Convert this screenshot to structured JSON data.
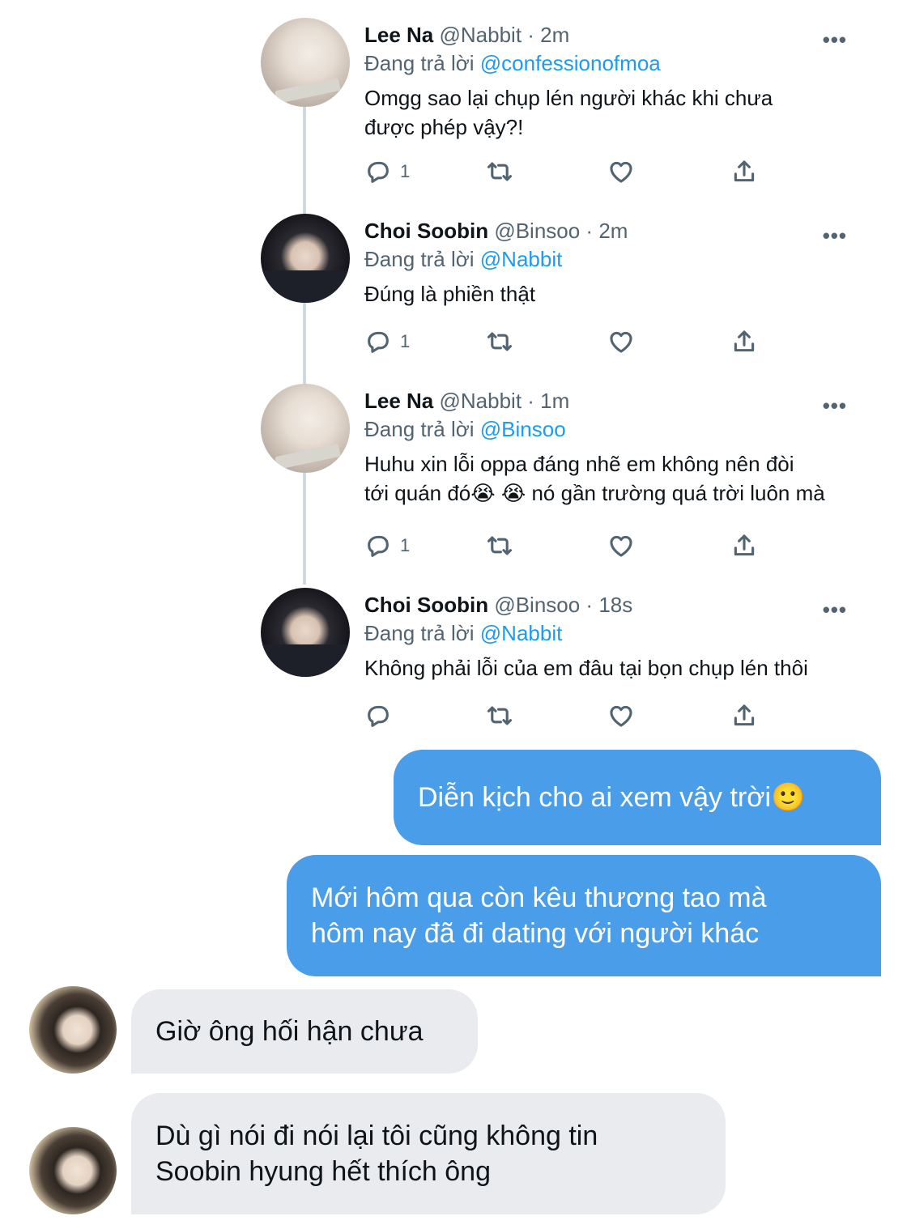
{
  "tweets": [
    {
      "name": "Lee Na",
      "meta": " @Nabbit · 2m",
      "reply_prefix": "Đang trả lời ",
      "reply_to": "@confessionofmoa",
      "text_lines": [
        "Omgg sao lại chụp lén người khác khi chưa",
        "được phép vậy?!"
      ],
      "reply_count": "1",
      "avatar": "cat-avatar"
    },
    {
      "name": "Choi Soobin",
      "meta": " @Binsoo · 2m",
      "reply_prefix": "Đang trả lời ",
      "reply_to": "@Nabbit",
      "text_lines": [
        "Đúng là phiền thật"
      ],
      "reply_count": "1",
      "avatar": "boy-avatar"
    },
    {
      "name": "Lee Na",
      "meta": " @Nabbit · 1m",
      "reply_prefix": "Đang trả lời ",
      "reply_to": "@Binsoo",
      "text_lines": [
        "Huhu xin lỗi oppa đáng nhẽ em  không nên đòi",
        "tới quán đó😭 😭 nó gần trường quá trời luôn mà"
      ],
      "reply_count": "1",
      "avatar": "cat-avatar"
    },
    {
      "name": "Choi Soobin",
      "meta": " @Binsoo · 18s",
      "reply_prefix": "Đang trả lời ",
      "reply_to": "@Nabbit",
      "text_lines": [
        "Không phải lỗi của em đâu tại bọn chụp lén thôi"
      ],
      "reply_count": "",
      "avatar": "boy-avatar"
    }
  ],
  "more_label": "•••",
  "icons": {
    "reply": "reply-icon",
    "retweet": "retweet-icon",
    "like": "like-icon",
    "share": "share-icon"
  },
  "messages": [
    {
      "side": "me",
      "lines": [
        "Diễn kịch cho ai xem vậy trời🙂"
      ]
    },
    {
      "side": "me",
      "lines": [
        "Mới hôm qua còn kêu thương tao mà",
        "hôm nay đã đi dating với người khác"
      ]
    },
    {
      "side": "them",
      "lines": [
        "Giờ ông hối hận chưa"
      ]
    },
    {
      "side": "them",
      "lines": [
        "Dù gì nói đi nói lại tôi cũng không tin",
        "Soobin hyung hết thích ông"
      ]
    }
  ],
  "colors": {
    "my_bubble": "#4a9de8",
    "their_bubble": "#e9ebee",
    "mention": "#1d9bf0",
    "muted": "#536471"
  }
}
